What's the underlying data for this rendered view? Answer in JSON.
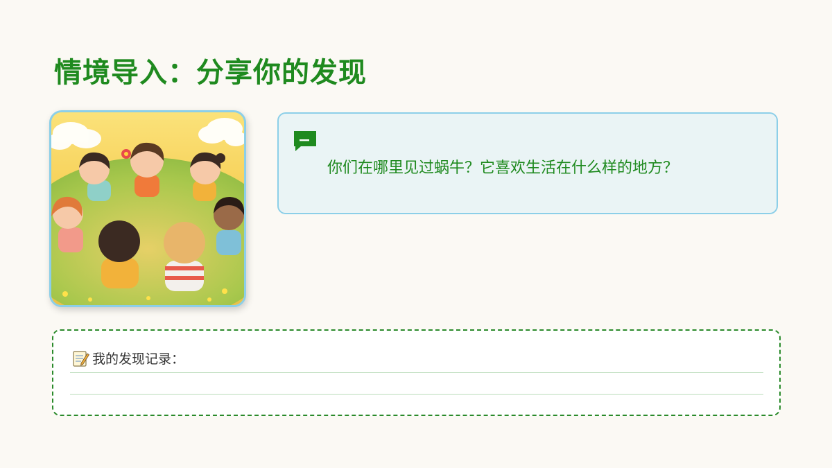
{
  "slide": {
    "title": "情境导入：分享你的发现",
    "question": {
      "icon": "chat-bubble-icon",
      "text": "你们在哪里见过蜗牛？它喜欢生活在什么样的地方？"
    },
    "record": {
      "icon": "memo-icon",
      "label": "我的发现记录："
    },
    "colors": {
      "title": "#1f8a1f",
      "card_border": "#8ccfe8",
      "card_bg": "#eaf4f5",
      "dashed_border": "#2a8a2a"
    }
  }
}
